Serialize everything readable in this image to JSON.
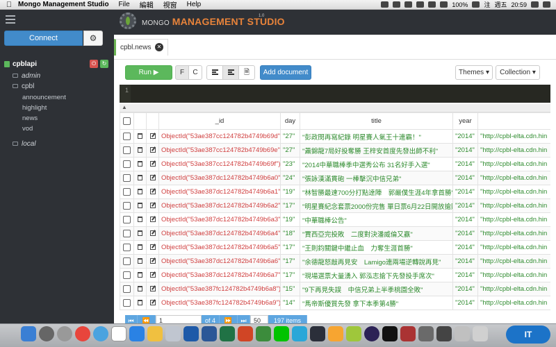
{
  "menubar": {
    "app_name": "Mongo Management Studio",
    "items": [
      "File",
      "編輯",
      "視窗",
      "Help"
    ],
    "battery": "100%",
    "input_method": "注",
    "day": "週五",
    "time": "20:59",
    "status_icons": [
      "dropbox-icon",
      "dropbox-icon",
      "evernote-icon",
      "chrome-icon",
      "adobe-icon",
      "wifi-icon",
      "volume-icon",
      "battery-icon",
      "user-icon",
      "search-icon",
      "list-icon"
    ]
  },
  "sidebar": {
    "connect_label": "Connect",
    "server_name": "cpblapi",
    "databases": [
      {
        "name": "admin",
        "italic": true
      },
      {
        "name": "cpbl",
        "italic": false,
        "collections": [
          "announcement",
          "highlight",
          "news",
          "vod"
        ]
      },
      {
        "name": "local",
        "italic": true
      }
    ]
  },
  "header": {
    "logo_small": "MONGO",
    "logo_big": "MANAGEMENT STUDIO",
    "version": "1.0"
  },
  "tab": {
    "label": "cpbl.news"
  },
  "toolbar": {
    "run_label": "Run",
    "f_label": "F",
    "c_label": "C",
    "add_document_label": "Add document",
    "themes_label": "Themes",
    "collection_label": "Collection"
  },
  "editor": {
    "line_number": "1"
  },
  "table": {
    "columns": [
      "_id",
      "day",
      "title",
      "year",
      ""
    ],
    "rows": [
      {
        "id": "ObjectId(\"53ae387cc124782b4749b69d\")",
        "day": "\"27\"",
        "title": "\"彭政閔再寫紀錄 明星賽人氣王十連霸！\"",
        "year": "\"2014\"",
        "link": "\"http://cpbl-elta.cdn.hin"
      },
      {
        "id": "ObjectId(\"53ae387cc124782b4749b69e\")",
        "day": "\"27\"",
        "title": "\"蕭錦龍7局好投奪勝 王梓安首度先發出師不利\"",
        "year": "\"2014\"",
        "link": "\"http://cpbl-elta.cdn.hin"
      },
      {
        "id": "ObjectId(\"53ae387cc124782b4749b69f\")",
        "day": "\"23\"",
        "title": "\"2014中華職棒季中選秀公布 31名好手入選\"",
        "year": "\"2014\"",
        "link": "\"http://cpbl-elta.cdn.hin"
      },
      {
        "id": "ObjectId(\"53ae387dc124782b4749b6a0\")",
        "day": "\"24\"",
        "title": "\"張詠漢滿貫砲 一棒擊沉中信兄弟\"",
        "year": "\"2014\"",
        "link": "\"http://cpbl-elta.cdn.hin"
      },
      {
        "id": "ObjectId(\"53ae387dc124782b4749b6a1\")",
        "day": "\"19\"",
        "title": "\"林智勝最速700分打點達陣　郭嚴僕生涯4年拿首勝\"",
        "year": "\"2014\"",
        "link": "\"http://cpbl-elta.cdn.hin"
      },
      {
        "id": "ObjectId(\"53ae387dc124782b4749b6a2\")",
        "day": "\"17\"",
        "title": "\"明星賽紀念套票2000份完售 單日票6月22日開放搶購\"",
        "year": "\"2014\"",
        "link": "\"http://cpbl-elta.cdn.hin"
      },
      {
        "id": "ObjectId(\"53ae387dc124782b4749b6a3\")",
        "day": "\"19\"",
        "title": "\"中華職棒公告\"",
        "year": "\"2014\"",
        "link": "\"http://cpbl-elta.cdn.hin"
      },
      {
        "id": "ObjectId(\"53ae387dc124782b4749b6a4\")",
        "day": "\"18\"",
        "title": "\"賈西亞完投敗　二度對決潘威倫又贏\"",
        "year": "\"2014\"",
        "link": "\"http://cpbl-elta.cdn.hin"
      },
      {
        "id": "ObjectId(\"53ae387dc124782b4749b6a5\")",
        "day": "\"17\"",
        "title": "\"王則鈞關鍵中繼止血　力奪生涯首勝\"",
        "year": "\"2014\"",
        "link": "\"http://cpbl-elta.cdn.hin"
      },
      {
        "id": "ObjectId(\"53ae387dc124782b4749b6a6\")",
        "day": "\"17\"",
        "title": "\"余德龍怒敲再見安　Lamigo連兩場逆轉說再見\"",
        "year": "\"2014\"",
        "link": "\"http://cpbl-elta.cdn.hin"
      },
      {
        "id": "ObjectId(\"53ae387dc124782b4749b6a7\")",
        "day": "\"17\"",
        "title": "\"現場選票大量湧入 郭泓志搶下先發投手席次\"",
        "year": "\"2014\"",
        "link": "\"http://cpbl-elta.cdn.hin"
      },
      {
        "id": "ObjectId(\"53ae387fc124782b4749b6a8\")",
        "day": "\"15\"",
        "title": "\"9下再見失誤　中信兄弟上半季桃園全敗\"",
        "year": "\"2014\"",
        "link": "\"http://cpbl-elta.cdn.hin"
      },
      {
        "id": "ObjectId(\"53ae387fc124782b4749b6a9\")",
        "day": "\"14\"",
        "title": "\"馬帝斯優質先發 拿下本季第4勝\"",
        "year": "\"2014\"",
        "link": "\"http://cpbl-elta.cdn.hin"
      }
    ]
  },
  "pager": {
    "page_value": "1",
    "of_pages": "of 4",
    "page_size": "50",
    "items_count": "197 items"
  },
  "dock": {
    "badge_text": "IT"
  },
  "colors": {
    "sidebar_bg": "#2e3136",
    "accent_blue": "#428bca",
    "run_green": "#5cb85c",
    "logo_orange": "#e8833a",
    "id_red": "#d04040",
    "string_green": "#2e8b2e"
  }
}
